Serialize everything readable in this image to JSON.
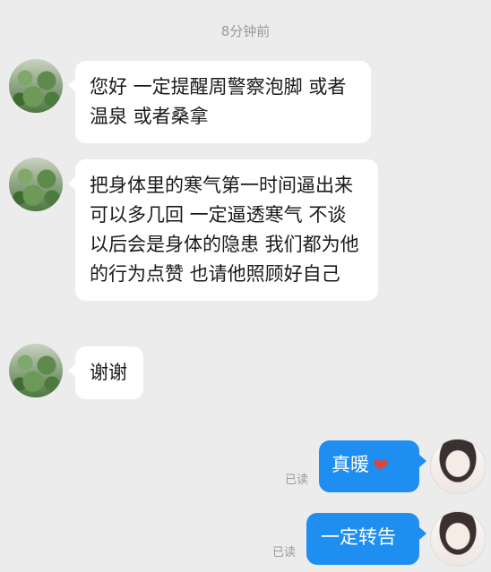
{
  "chat": {
    "timestamp": "8分钟前",
    "messages": [
      {
        "side": "left",
        "text": "您好 一定提醒周警察泡脚 或者温泉 或者桑拿"
      },
      {
        "side": "left",
        "text": "把身体里的寒气第一时间逼出来 可以多几回 一定逼透寒气 不谈以后会是身体的隐患 我们都为他的行为点赞 也请他照顾好自己"
      },
      {
        "side": "left",
        "text": "谢谢"
      },
      {
        "side": "right",
        "text": "真暖",
        "emoji": "heart",
        "status": "已读"
      },
      {
        "side": "right",
        "text": "一定转告",
        "status": "已读"
      }
    ]
  },
  "icons": {
    "heart": "❤"
  },
  "colors": {
    "background": "#ececec",
    "incoming_bubble": "#ffffff",
    "outgoing_bubble": "#1f8ef1",
    "read_status": "#9a9a9a",
    "heart": "#e2443a"
  }
}
